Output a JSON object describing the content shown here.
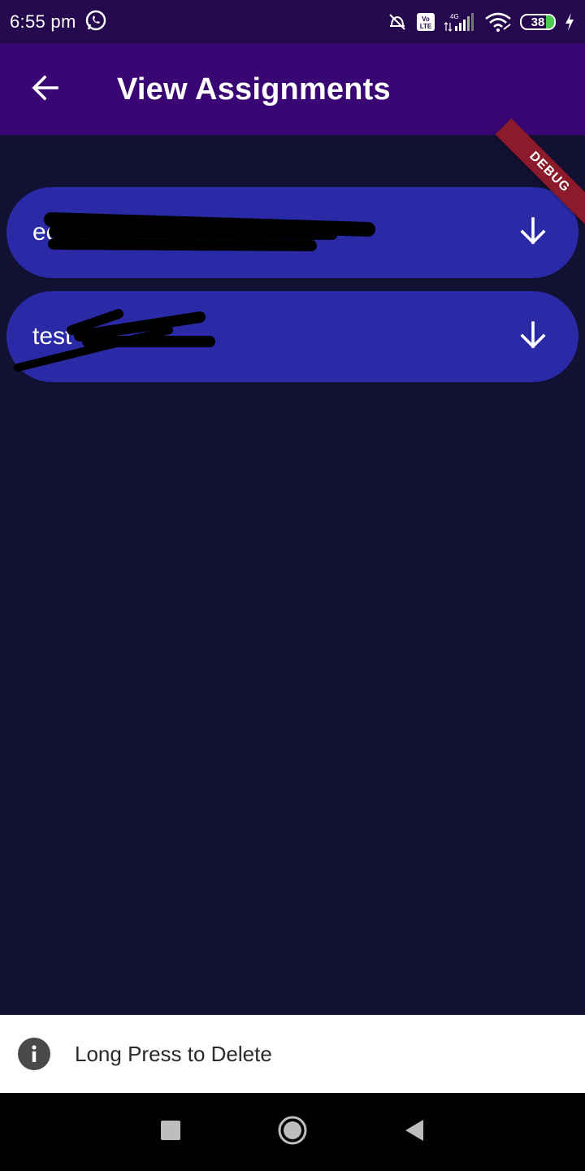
{
  "status_bar": {
    "time": "6:55 pm",
    "network_label": "4G",
    "volte_label": "Vo LTE",
    "battery_level": "38",
    "icons": [
      "whatsapp-icon",
      "alarm-off-icon",
      "volte-icon",
      "signal-icon",
      "wifi-icon",
      "battery-icon",
      "charging-icon"
    ]
  },
  "app_bar": {
    "title": "View Assignments",
    "back_icon": "arrow-left-icon"
  },
  "debug_banner": "DEBUG",
  "assignments": [
    {
      "label": "ee",
      "action_icon": "arrow-down-icon"
    },
    {
      "label": "test",
      "action_icon": "arrow-down-icon"
    }
  ],
  "snackbar": {
    "icon": "info-icon",
    "message": "Long Press to Delete"
  },
  "nav_bar": {
    "buttons": [
      "recents-icon",
      "home-icon",
      "back-triangle-icon"
    ]
  },
  "colors": {
    "status_bar": "#26084f",
    "app_bar": "#3a0674",
    "background": "#121133",
    "item": "#2a2aa6",
    "debug_ribbon": "#8b1a2b",
    "snackbar": "#ffffff"
  }
}
